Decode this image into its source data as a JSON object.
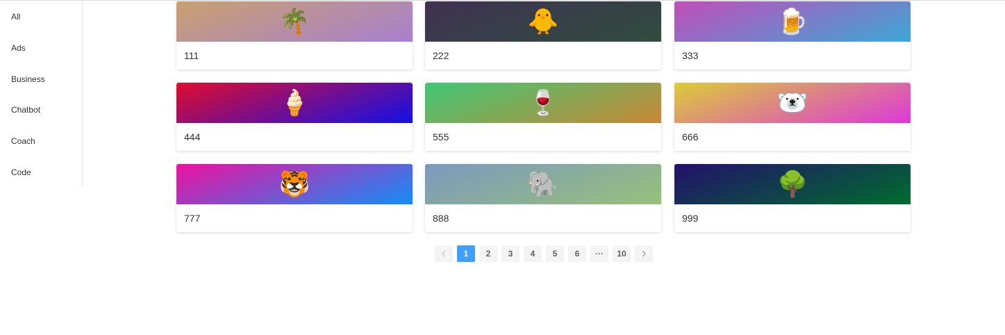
{
  "sidebar": {
    "items": [
      {
        "label": "All"
      },
      {
        "label": "Ads"
      },
      {
        "label": "Business"
      },
      {
        "label": "Chatbot"
      },
      {
        "label": "Coach"
      },
      {
        "label": "Code"
      }
    ]
  },
  "cards": [
    {
      "label": "111",
      "icon": "palm-tree-icon",
      "emoji": "🌴",
      "gradient": [
        "#c9a16f",
        "#a77fcf"
      ]
    },
    {
      "label": "222",
      "icon": "baby-chick-icon",
      "emoji": "🐥",
      "gradient": [
        "#403152",
        "#2f4d3e"
      ]
    },
    {
      "label": "333",
      "icon": "beer-mug-icon",
      "emoji": "🍺",
      "gradient": [
        "#c34db9",
        "#3ba7d6"
      ]
    },
    {
      "label": "444",
      "icon": "ice-cream-icon",
      "emoji": "🍦",
      "gradient": [
        "#e00d2c",
        "#1211e8"
      ]
    },
    {
      "label": "555",
      "icon": "wine-glass-icon",
      "emoji": "🍷",
      "gradient": [
        "#3fc876",
        "#c88836"
      ]
    },
    {
      "label": "666",
      "icon": "polar-bear-icon",
      "emoji": "🐻‍❄️",
      "gradient": [
        "#dccc36",
        "#dc38d8"
      ]
    },
    {
      "label": "777",
      "icon": "tiger-icon",
      "emoji": "🐯",
      "gradient": [
        "#ef10a0",
        "#118ff8"
      ]
    },
    {
      "label": "888",
      "icon": "elephant-icon",
      "emoji": "🐘",
      "gradient": [
        "#7c98c0",
        "#98c07a"
      ]
    },
    {
      "label": "999",
      "icon": "tree-icon",
      "emoji": "🌳",
      "gradient": [
        "#23106d",
        "#016c2e"
      ]
    }
  ],
  "pagination": {
    "prev_icon": "chevron-left-icon",
    "next_icon": "chevron-right-icon",
    "pages": [
      "1",
      "2",
      "3",
      "4",
      "5",
      "6"
    ],
    "ellipsis": "···",
    "last": "10",
    "current": "1"
  },
  "colors": {
    "accent": "#409eff",
    "pager_bg": "#f4f4f5"
  }
}
